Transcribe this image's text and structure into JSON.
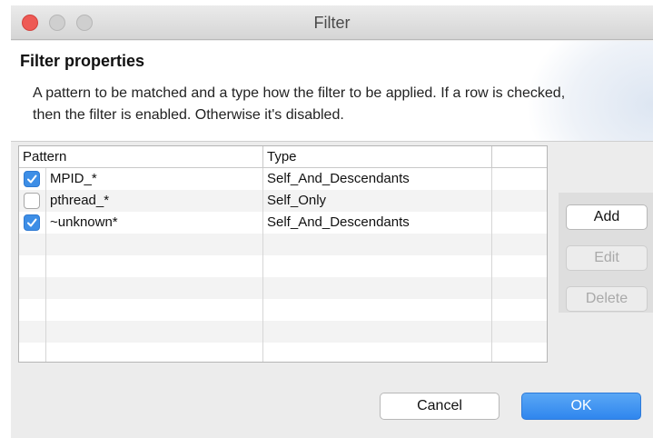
{
  "window": {
    "title": "Filter"
  },
  "header": {
    "title": "Filter properties",
    "description": "A pattern to be matched and a type how the filter to be applied. If a row is checked, then the filter is enabled. Otherwise it's disabled."
  },
  "table": {
    "columns": [
      "Pattern",
      "Type",
      ""
    ],
    "rows": [
      {
        "checked": true,
        "pattern": "MPID_*",
        "type": "Self_And_Descendants"
      },
      {
        "checked": false,
        "pattern": "pthread_*",
        "type": "Self_Only"
      },
      {
        "checked": true,
        "pattern": "~unknown*",
        "type": "Self_And_Descendants"
      }
    ]
  },
  "side_buttons": {
    "add": {
      "label": "Add",
      "enabled": true
    },
    "edit": {
      "label": "Edit",
      "enabled": false
    },
    "delete": {
      "label": "Delete",
      "enabled": false
    }
  },
  "footer": {
    "cancel_label": "Cancel",
    "ok_label": "OK"
  },
  "colors": {
    "accent": "#3d8ee6",
    "close": "#ee5a55"
  }
}
